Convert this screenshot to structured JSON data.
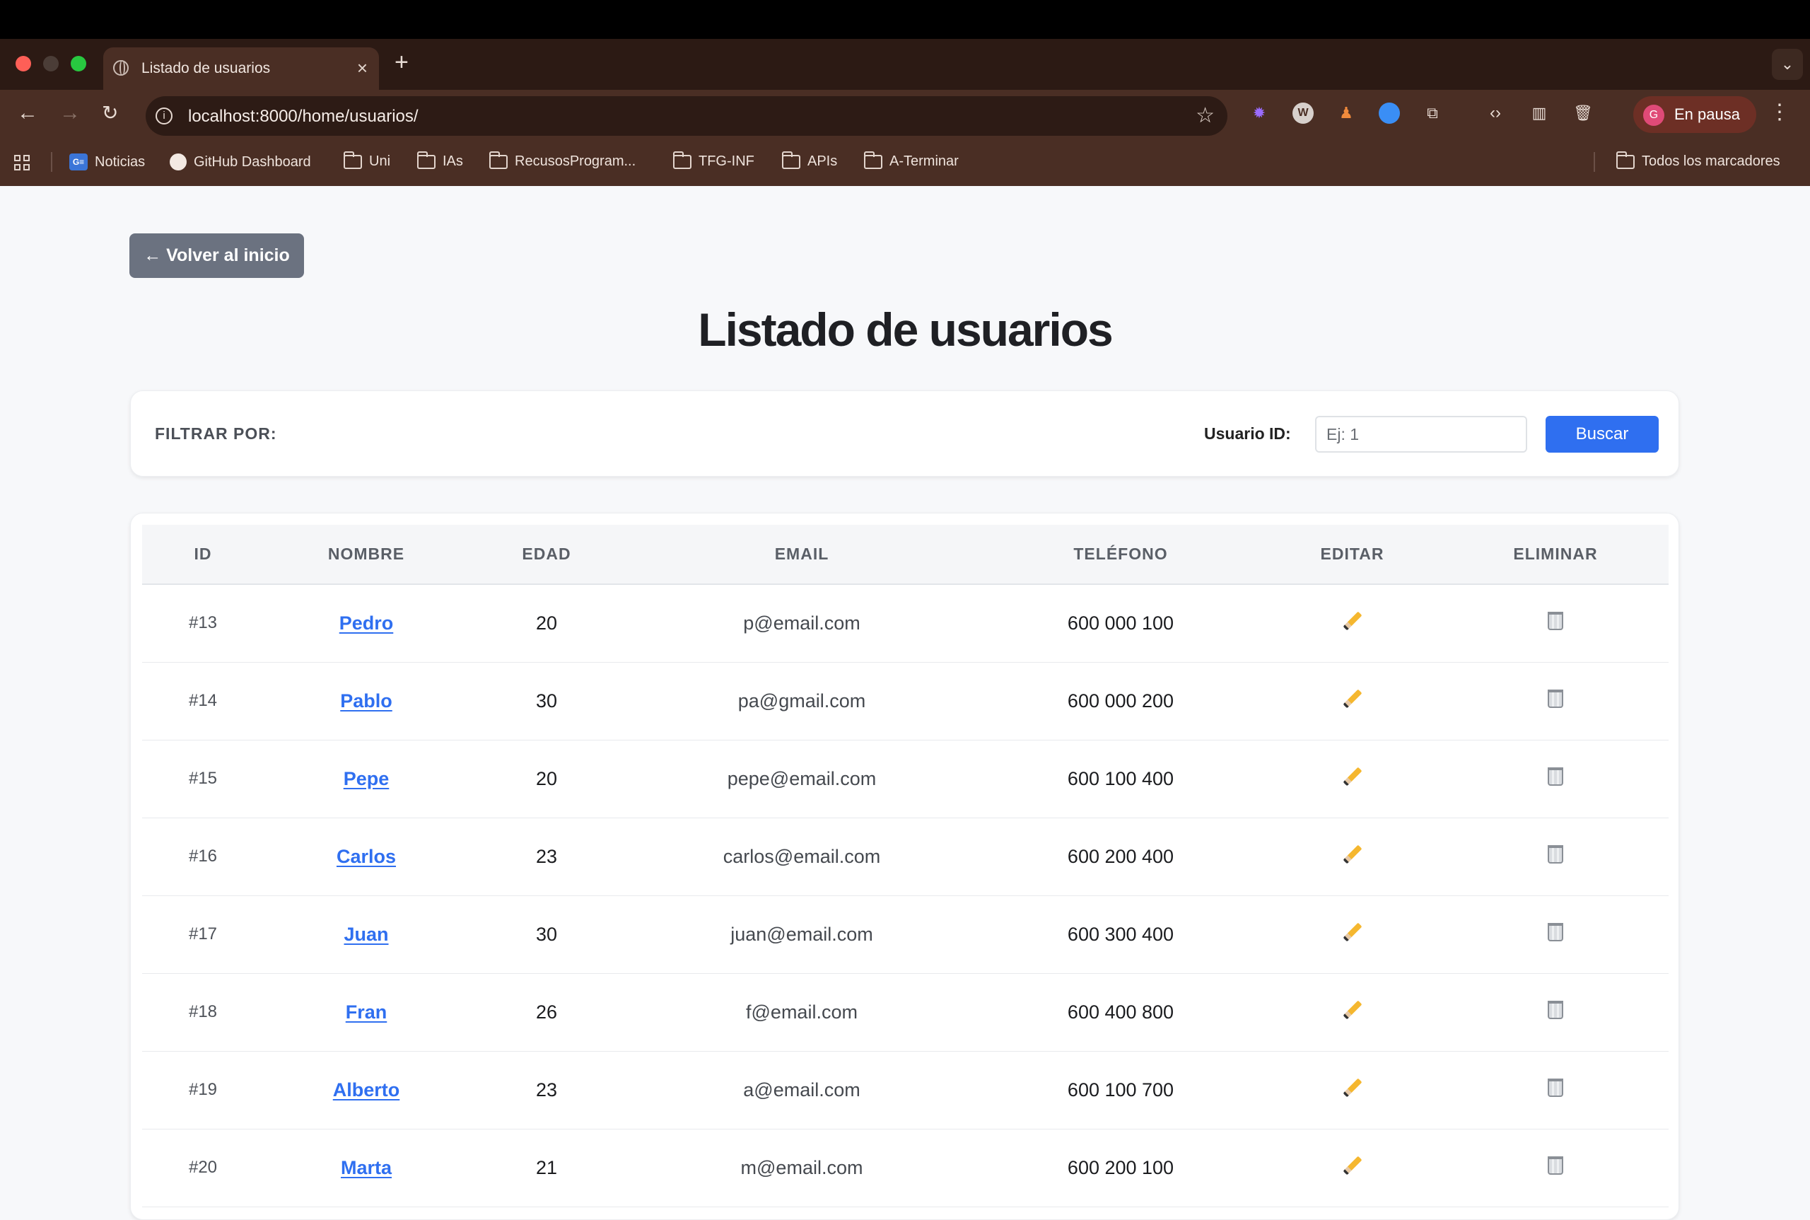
{
  "browser": {
    "tab_title": "Listado de usuarios",
    "url": "localhost:8000/home/usuarios/",
    "profile_initial": "G",
    "profile_label": "En pausa",
    "bookmarks": [
      {
        "label": "Noticias",
        "icon": "news-icon"
      },
      {
        "label": "GitHub Dashboard",
        "icon": "github-icon"
      },
      {
        "label": "Uni",
        "icon": "folder-icon"
      },
      {
        "label": "IAs",
        "icon": "folder-icon"
      },
      {
        "label": "RecusosProgram...",
        "icon": "folder-icon"
      },
      {
        "label": "TFG-INF",
        "icon": "folder-icon"
      },
      {
        "label": "APIs",
        "icon": "folder-icon"
      },
      {
        "label": "A-Terminar",
        "icon": "folder-icon"
      }
    ],
    "all_bookmarks": "Todos los marcadores"
  },
  "page": {
    "back_label": "← Volver al inicio",
    "title": "Listado de usuarios",
    "filter": {
      "label": "FILTRAR POR:",
      "uid_label": "Usuario ID:",
      "uid_placeholder": "Ej: 1",
      "search_label": "Buscar"
    },
    "table": {
      "headers": [
        "ID",
        "NOMBRE",
        "EDAD",
        "EMAIL",
        "TELÉFONO",
        "EDITAR",
        "ELIMINAR"
      ],
      "rows": [
        {
          "id": "#13",
          "name": "Pedro",
          "age": "20",
          "email": "p@email.com",
          "phone": "600 000 100"
        },
        {
          "id": "#14",
          "name": "Pablo",
          "age": "30",
          "email": "pa@gmail.com",
          "phone": "600 000 200"
        },
        {
          "id": "#15",
          "name": "Pepe",
          "age": "20",
          "email": "pepe@email.com",
          "phone": "600 100 400"
        },
        {
          "id": "#16",
          "name": "Carlos",
          "age": "23",
          "email": "carlos@email.com",
          "phone": "600 200 400"
        },
        {
          "id": "#17",
          "name": "Juan",
          "age": "30",
          "email": "juan@email.com",
          "phone": "600 300 400"
        },
        {
          "id": "#18",
          "name": "Fran",
          "age": "26",
          "email": "f@email.com",
          "phone": "600 400 800"
        },
        {
          "id": "#19",
          "name": "Alberto",
          "age": "23",
          "email": "a@email.com",
          "phone": "600 100 700"
        },
        {
          "id": "#20",
          "name": "Marta",
          "age": "21",
          "email": "m@email.com",
          "phone": "600 200 100"
        }
      ]
    }
  },
  "colors": {
    "accent": "#2f6ff0",
    "back_button": "#6b7280",
    "chrome": "#4a2e24"
  }
}
